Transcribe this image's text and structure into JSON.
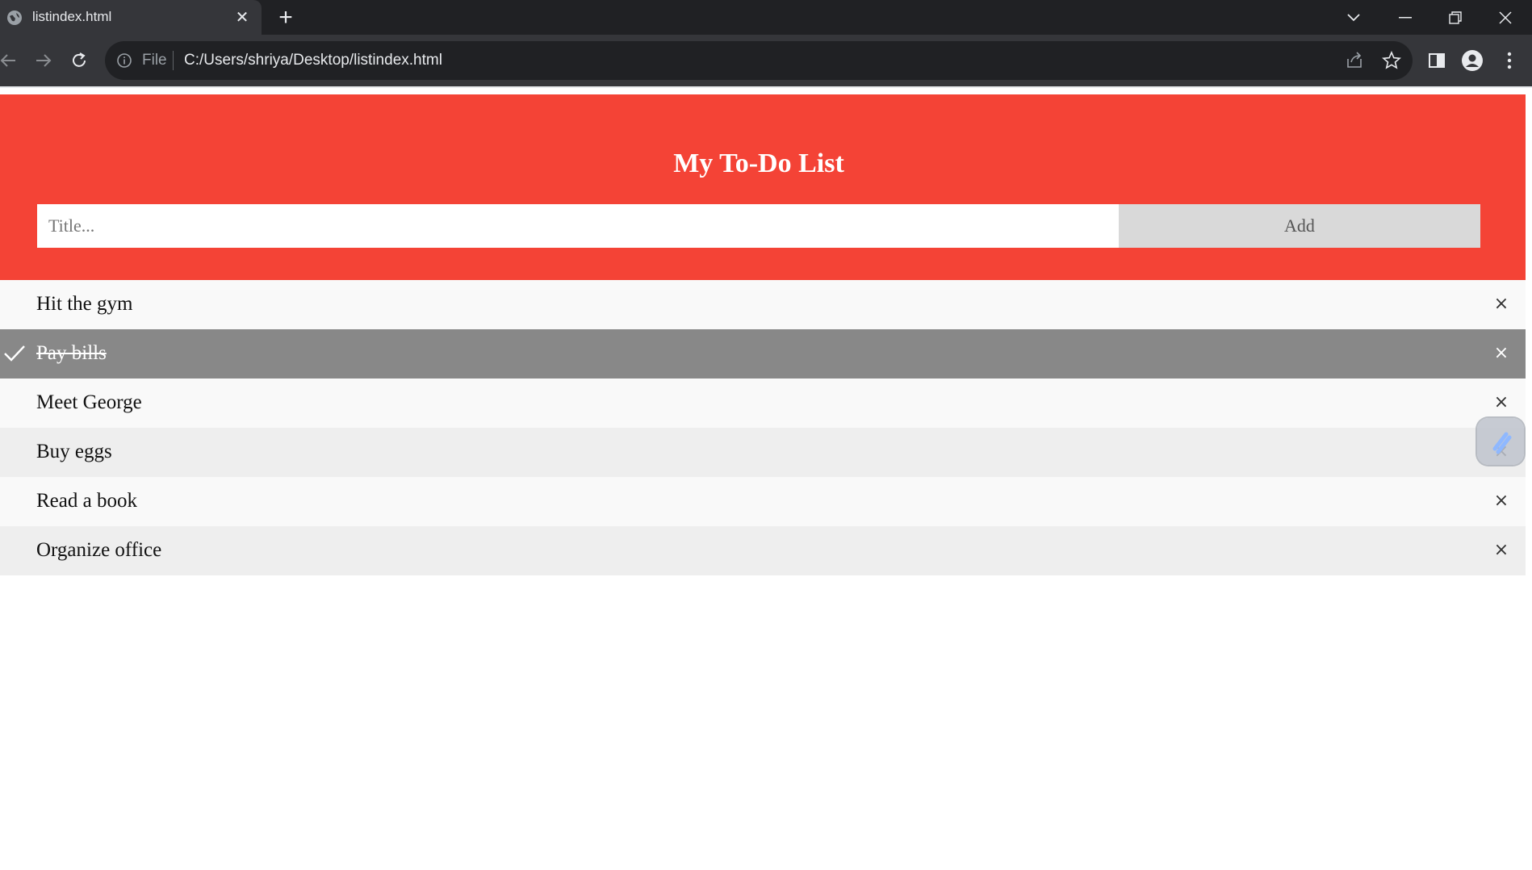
{
  "browser": {
    "tab_title": "listindex.html",
    "tab_close": "✕",
    "new_tab": "+",
    "scheme_label": "File",
    "url": "C:/Users/shriya/Desktop/listindex.html"
  },
  "page": {
    "heading": "My To-Do List",
    "input": {
      "placeholder": "Title...",
      "value": ""
    },
    "add_label": "Add"
  },
  "todos": [
    {
      "text": "Hit the gym",
      "checked": false
    },
    {
      "text": "Pay bills",
      "checked": true
    },
    {
      "text": "Meet George",
      "checked": false
    },
    {
      "text": "Buy eggs",
      "checked": false
    },
    {
      "text": "Read a book",
      "checked": false
    },
    {
      "text": "Organize office",
      "checked": false
    }
  ],
  "close_glyph": "×",
  "colors": {
    "header": "#f44336",
    "checked_row": "#888888",
    "row_odd": "#f9f9f9",
    "row_even": "#eeeeee",
    "add_button": "#d9d9d9"
  }
}
